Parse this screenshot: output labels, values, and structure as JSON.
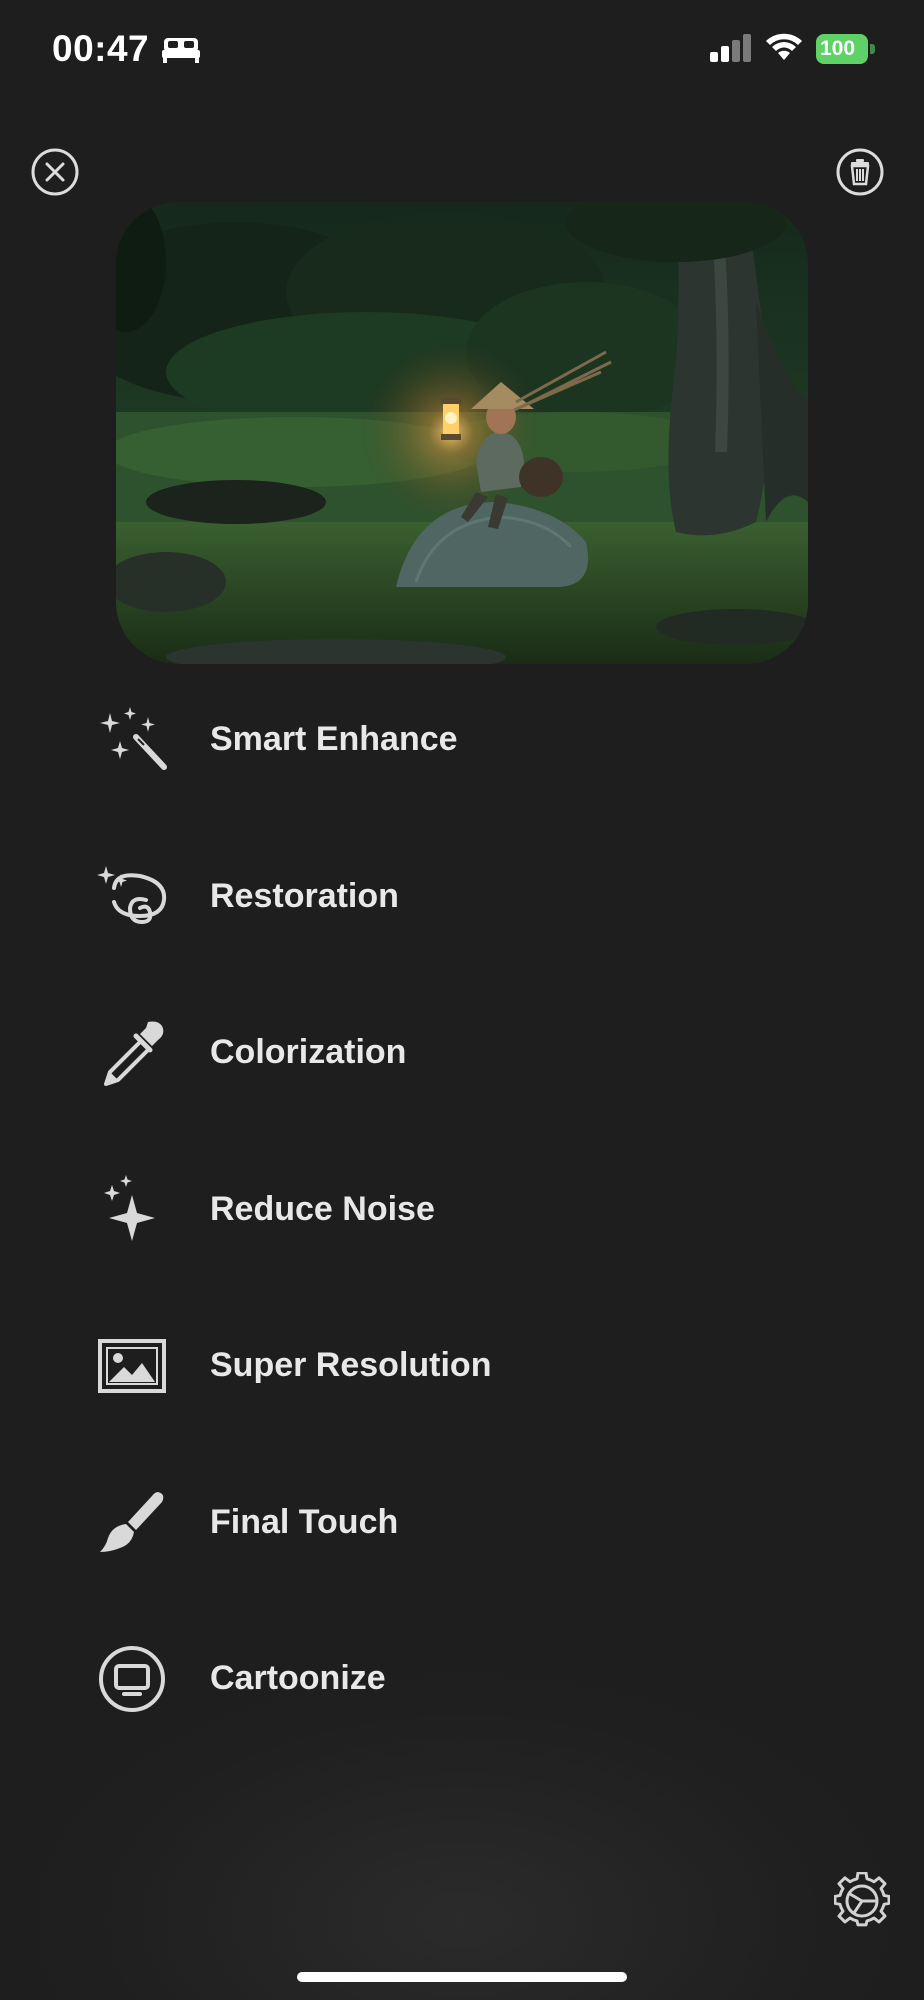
{
  "status_bar": {
    "time": "00:47",
    "battery": "100",
    "icons": [
      "bed-icon",
      "cellular-signal-icon",
      "wifi-icon",
      "battery-charging-icon"
    ]
  },
  "toolbar": {
    "close_icon": "close-circle-icon",
    "delete_icon": "trash-icon"
  },
  "photo": {
    "description_icon": "photo-preview"
  },
  "menu": {
    "items": [
      {
        "label": "Smart Enhance",
        "icon": "magic-wand-icon"
      },
      {
        "label": "Restoration",
        "icon": "restoration-icon"
      },
      {
        "label": "Colorization",
        "icon": "dropper-icon"
      },
      {
        "label": "Reduce Noise",
        "icon": "sparkles-icon"
      },
      {
        "label": "Super Resolution",
        "icon": "image-icon"
      },
      {
        "label": "Final Touch",
        "icon": "paintbrush-icon"
      },
      {
        "label": "Cartoonize",
        "icon": "display-circle-icon"
      }
    ]
  },
  "footer": {
    "settings_icon": "settings-gear-icon"
  },
  "colors": {
    "background": "#1f1f1f",
    "text": "#e8e8e8",
    "icon": "#d9d9d9",
    "battery": "#5fd166"
  }
}
